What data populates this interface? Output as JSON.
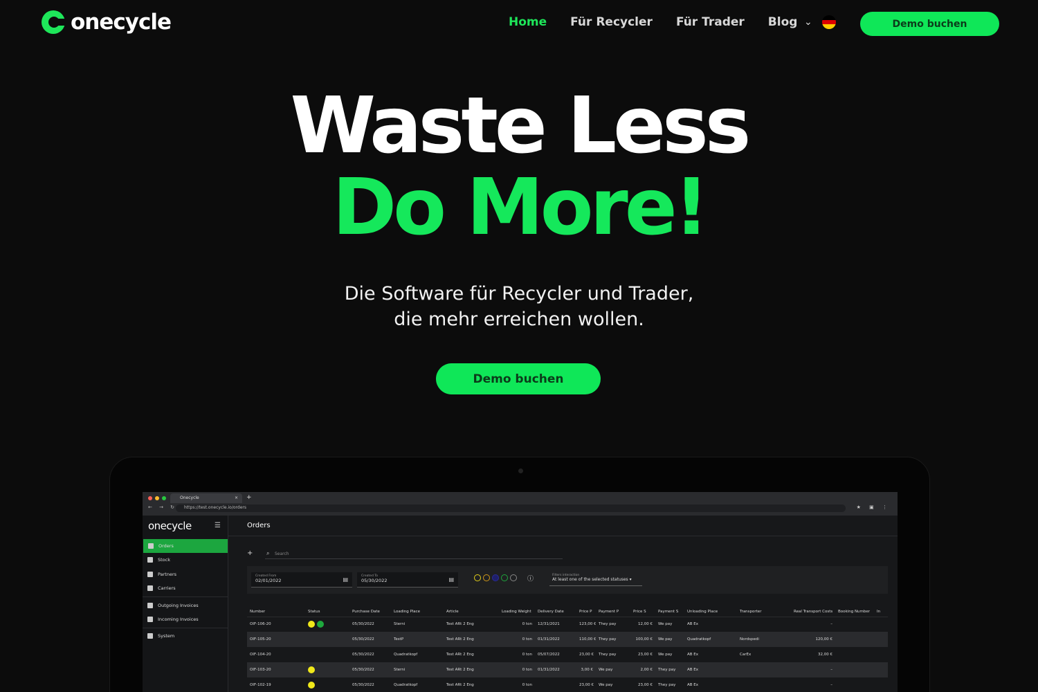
{
  "nav": {
    "logo_text": "onecycle",
    "items": [
      {
        "label": "Home",
        "active": true
      },
      {
        "label": "Für Recycler",
        "active": false
      },
      {
        "label": "Für Trader",
        "active": false
      },
      {
        "label": "Blog",
        "active": false
      }
    ],
    "lang_chevron": "chevron-down-icon",
    "flag": "german-flag-icon",
    "cta_label": "Demo buchen"
  },
  "hero": {
    "line1": "Waste Less",
    "line2": "Do More!",
    "sub_line1": "Die Software für Recycler und Trader,",
    "sub_line2": "die mehr erreichen wollen.",
    "cta_label": "Demo buchen"
  },
  "colors": {
    "accent": "#15e85b",
    "background": "#0c0c0c"
  },
  "app": {
    "browser": {
      "tab_title": "Onecycle",
      "url": "https://test.onecycle.io/orders"
    },
    "logo_text": "onecycle",
    "page_title": "Orders",
    "sidebar": [
      {
        "label": "Orders",
        "active": true
      },
      {
        "label": "Stock"
      },
      {
        "label": "Partners"
      },
      {
        "label": "Carriers"
      },
      {
        "label": "Outgoing Invoices"
      },
      {
        "label": "Incoming Invoices"
      },
      {
        "label": "System"
      }
    ],
    "search_placeholder": "Search",
    "filters": {
      "created_from_label": "Created From",
      "created_from": "02/01/2022",
      "created_to_label": "Created To",
      "created_to": "05/30/2022",
      "interaction_label": "Filters interaction",
      "interaction_value": "At least one of the selected statuses"
    },
    "columns": [
      "Number",
      "Status",
      "Purchase Date",
      "Loading Place",
      "Article",
      "Loading Weight",
      "Delivery Date",
      "Price P",
      "Payment P",
      "Price S",
      "Payment S",
      "Unloading Place",
      "Transporter",
      "Real Transport Costs",
      "Booking Number",
      "In"
    ],
    "rows": [
      {
        "number": "OIF-106-20",
        "status": [
          "#f0e81a",
          "#1ea83d"
        ],
        "purchase_date": "05/30/2022",
        "loading_place": "Sterni",
        "article": "Test ARt 2 Eng",
        "weight": "0 ton",
        "delivery_date": "12/31/2021",
        "price_p": "123,00 €",
        "payment_p": "They pay",
        "price_s": "12,00 €",
        "payment_s": "We pay",
        "unloading": "AB Ex",
        "transporter": "",
        "transport_costs": "–",
        "booking": ""
      },
      {
        "number": "OIF-105-20",
        "status": [],
        "purchase_date": "05/30/2022",
        "loading_place": "TestP",
        "article": "Test ARt 2 Eng",
        "weight": "0 ton",
        "delivery_date": "01/31/2022",
        "price_p": "110,00 €",
        "payment_p": "They pay",
        "price_s": "100,00 €",
        "payment_s": "We pay",
        "unloading": "Quadratkopf",
        "transporter": "Nordspedi",
        "transport_costs": "120,00 €",
        "booking": ""
      },
      {
        "number": "OIF-104-20",
        "status": [],
        "purchase_date": "05/30/2022",
        "loading_place": "Quadratkopf",
        "article": "Test ARt 2 Eng",
        "weight": "0 ton",
        "delivery_date": "05/07/2022",
        "price_p": "23,00 €",
        "payment_p": "They pay",
        "price_s": "23,00 €",
        "payment_s": "We pay",
        "unloading": "AB Ex",
        "transporter": "CarEx",
        "transport_costs": "32,00 €",
        "booking": ""
      },
      {
        "number": "OIF-103-20",
        "status": [
          "#f0e81a"
        ],
        "purchase_date": "05/30/2022",
        "loading_place": "Sterni",
        "article": "Test ARt 2 Eng",
        "weight": "0 ton",
        "delivery_date": "01/31/2022",
        "price_p": "3,00 €",
        "payment_p": "We pay",
        "price_s": "2,00 €",
        "payment_s": "They pay",
        "unloading": "AB Ex",
        "transporter": "",
        "transport_costs": "–",
        "booking": ""
      },
      {
        "number": "OIF-102-19",
        "status": [
          "#f0e81a"
        ],
        "purchase_date": "05/30/2022",
        "loading_place": "Quadratkopf",
        "article": "Test ARt 2 Eng",
        "weight": "0 ton",
        "delivery_date": "",
        "price_p": "23,00 €",
        "payment_p": "We pay",
        "price_s": "23,00 €",
        "payment_s": "They pay",
        "unloading": "AB Ex",
        "transporter": "",
        "transport_costs": "–",
        "booking": ""
      }
    ]
  }
}
